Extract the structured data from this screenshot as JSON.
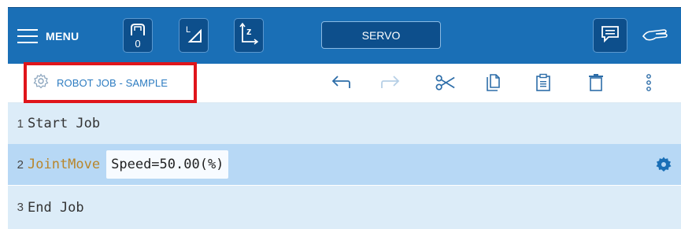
{
  "topbar": {
    "menu_label": "MENU",
    "tool_counter": "0",
    "servo_label": "SERVO"
  },
  "toolbar": {
    "job_title": "ROBOT JOB - SAMPLE",
    "icons": [
      "undo-icon",
      "redo-icon",
      "cut-icon",
      "copy-icon",
      "paste-icon",
      "delete-icon",
      "more-vertical-icon"
    ]
  },
  "lines": [
    {
      "number": "1",
      "command": "Start Job"
    },
    {
      "number": "2",
      "command": "JointMove",
      "param": "Speed=50.00(%)"
    },
    {
      "number": "3",
      "command": "End Job"
    }
  ],
  "colors": {
    "topbar": "#1a6fb6",
    "button_dark": "#0d4f8c",
    "title_text": "#2d7cc1",
    "highlight_box": "#e0151b",
    "row_light": "#dcecf8",
    "row_selected": "#b7d8f5",
    "command_keyword": "#b8862b",
    "gear_blue": "#1a6fb6"
  }
}
